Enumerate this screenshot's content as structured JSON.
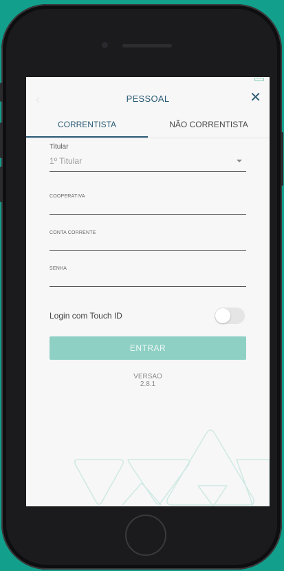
{
  "screen": {
    "header": {
      "title": "PESSOAL",
      "back_icon": "chevron-left-icon",
      "close_icon": "close-icon"
    },
    "tabs": [
      {
        "label": "CORRENTISTA",
        "active": true
      },
      {
        "label": "NÃO CORRENTISTA",
        "active": false
      }
    ],
    "form": {
      "titular": {
        "label": "Titular",
        "value": "1º Titular"
      },
      "cooperativa": {
        "label": "COOPERATIVA",
        "value": ""
      },
      "conta_corrente": {
        "label": "CONTA CORRENTE",
        "value": ""
      },
      "senha": {
        "label": "SENHA",
        "value": ""
      },
      "touch_id": {
        "label": "Login com Touch ID",
        "enabled": false
      },
      "submit_label": "ENTRAR"
    },
    "version": {
      "label": "VERSAO",
      "value": "2.8.1"
    }
  },
  "colors": {
    "background": "#12a08c",
    "primary": "#2b5b76",
    "button": "#8fd0c5",
    "decoration": "#cfe9e3"
  }
}
